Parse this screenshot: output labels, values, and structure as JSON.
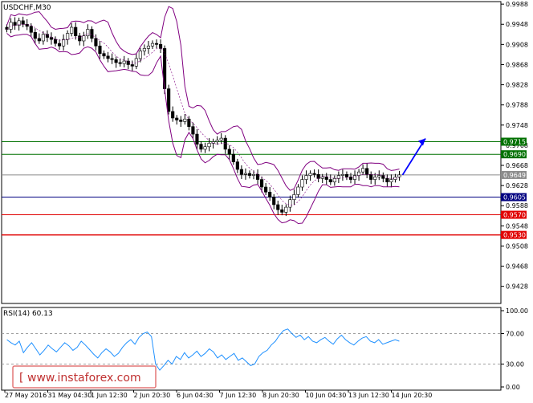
{
  "chart_data": [
    {
      "type": "candlestick",
      "title": "USDCHF,M30",
      "symbol": "USDCHF",
      "timeframe": "M30",
      "indicator_overlay": "Bollinger Bands",
      "y_ticks": [
        "0.9988",
        "0.9948",
        "0.9908",
        "0.9868",
        "0.9828",
        "0.9788",
        "0.9748",
        "0.9708",
        "0.9668",
        "0.9628",
        "0.9588",
        "0.9548",
        "0.9508",
        "0.9468",
        "0.9428"
      ],
      "ylim": [
        0.9394,
        0.9993
      ],
      "x_ticks": [
        "27 May 2016",
        "31 May 04:30",
        "1 Jun 12:30",
        "2 Jun 20:30",
        "6 Jun 04:30",
        "7 Jun 12:30",
        "8 Jun 20:30",
        "10 Jun 04:30",
        "13 Jun 12:30",
        "14 Jun 20:30"
      ],
      "levels": [
        {
          "value": 0.9715,
          "label": "0.9715",
          "color": "#007000"
        },
        {
          "value": 0.969,
          "label": "0.9690",
          "color": "#007000"
        },
        {
          "value": 0.9649,
          "label": "0.9649",
          "color": "#8c8c8c"
        },
        {
          "value": 0.9605,
          "label": "0.9605",
          "color": "#000080"
        },
        {
          "value": 0.957,
          "label": "0.9570",
          "color": "#e00000"
        },
        {
          "value": 0.953,
          "label": "0.9530",
          "color": "#e00000"
        }
      ],
      "arrow": {
        "from": 0.9649,
        "to": 0.9715,
        "color": "#0000ff",
        "direction": "up"
      },
      "series": [
        {
          "values": [
            0.9938,
            0.9952,
            0.9946,
            0.9955,
            0.9948,
            0.9944,
            0.9932,
            0.992,
            0.9915,
            0.9928,
            0.9922,
            0.9918,
            0.991,
            0.9905,
            0.9918,
            0.993,
            0.9942,
            0.9925,
            0.9915,
            0.9925,
            0.9938,
            0.992,
            0.9905,
            0.989,
            0.9885,
            0.988,
            0.9878,
            0.9872,
            0.987,
            0.9875,
            0.9868,
            0.9865,
            0.988,
            0.9895,
            0.99,
            0.9905,
            0.991,
            0.9908,
            0.99,
            0.982,
            0.9775,
            0.9762,
            0.9758,
            0.9755,
            0.976,
            0.9745,
            0.973,
            0.971,
            0.97,
            0.9705,
            0.9712,
            0.9715,
            0.9718,
            0.9722,
            0.97,
            0.969,
            0.9675,
            0.966,
            0.965,
            0.9652,
            0.9648,
            0.965,
            0.964,
            0.9625,
            0.9615,
            0.9605,
            0.959,
            0.958,
            0.9575,
            0.9585,
            0.96,
            0.961,
            0.9625,
            0.964,
            0.9648,
            0.9652,
            0.965,
            0.9642,
            0.9645,
            0.964,
            0.9635,
            0.9642,
            0.9648,
            0.965,
            0.9645,
            0.964,
            0.9648,
            0.9655,
            0.9662,
            0.965,
            0.964,
            0.9645,
            0.9648,
            0.9642,
            0.9635,
            0.964,
            0.9645,
            0.9649
          ]
        }
      ]
    },
    {
      "type": "line",
      "title": "RSI(14) 60.13",
      "indicator": "RSI(14)",
      "current_value": 60.13,
      "y_ticks": [
        "100.00",
        "70.00",
        "30.00",
        "0.00"
      ],
      "ylim": [
        0,
        100
      ],
      "reference_levels": [
        70,
        30
      ],
      "x_ticks": [
        "27 May 2016",
        "31 May 04:30",
        "1 Jun 12:30",
        "2 Jun 20:30",
        "6 Jun 04:30",
        "7 Jun 12:30",
        "8 Jun 20:30",
        "10 Jun 04:30",
        "13 Jun 12:30",
        "14 Jun 20:30"
      ],
      "series": [
        {
          "values": [
            62,
            58,
            55,
            60,
            45,
            52,
            58,
            50,
            42,
            48,
            55,
            50,
            46,
            52,
            58,
            54,
            48,
            52,
            60,
            55,
            49,
            43,
            38,
            45,
            50,
            46,
            40,
            44,
            52,
            58,
            62,
            56,
            65,
            70,
            72,
            66,
            30,
            22,
            28,
            35,
            30,
            40,
            36,
            45,
            38,
            42,
            47,
            40,
            44,
            50,
            46,
            38,
            42,
            36,
            40,
            44,
            35,
            38,
            33,
            28,
            30,
            40,
            45,
            48,
            55,
            60,
            68,
            74,
            76,
            70,
            65,
            68,
            62,
            66,
            60,
            58,
            62,
            65,
            60,
            56,
            63,
            68,
            62,
            58,
            55,
            60,
            64,
            66,
            60,
            58,
            62,
            56,
            58,
            60,
            62,
            60
          ]
        }
      ]
    }
  ],
  "watermark": "www.instaforex.com"
}
